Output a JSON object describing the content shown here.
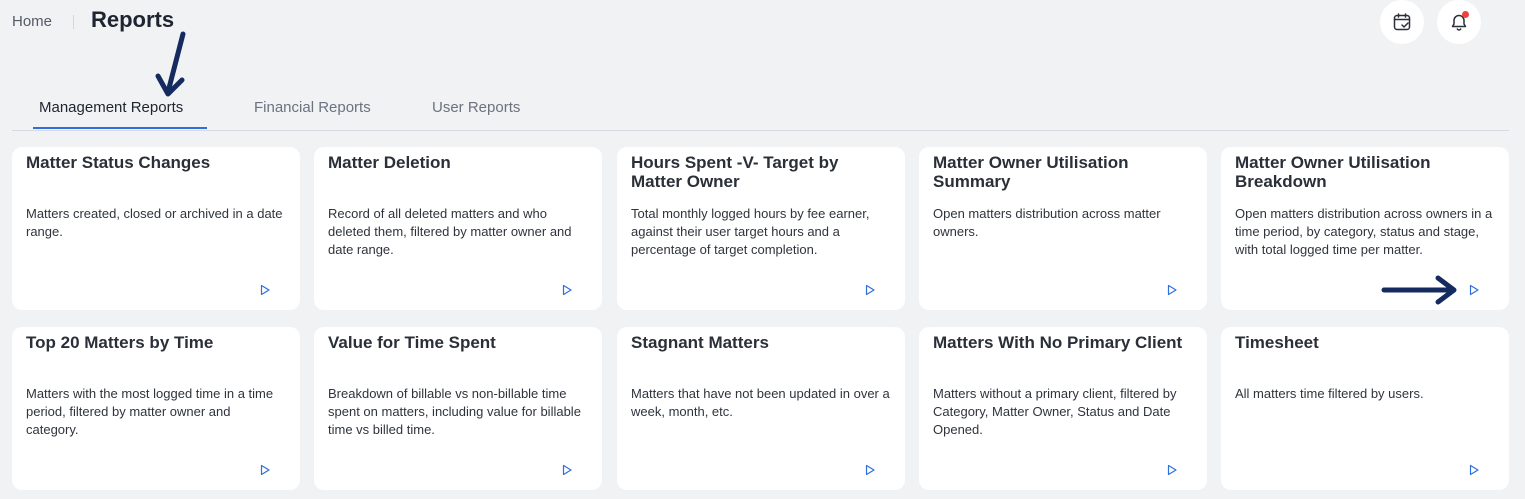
{
  "header": {
    "breadcrumb_home": "Home",
    "title": "Reports",
    "calendar_icon": "calendar-check-icon",
    "bell_icon": "bell-icon",
    "notification_dot_color": "#f0413a"
  },
  "tabs": [
    {
      "label": "Management Reports",
      "active": true
    },
    {
      "label": "Financial Reports",
      "active": false
    },
    {
      "label": "User Reports",
      "active": false
    }
  ],
  "accent_color": "#2f6fdc",
  "cards": [
    {
      "title": "Matter Status Changes",
      "description": "Matters created, closed or archived in a date range."
    },
    {
      "title": "Matter Deletion",
      "description": "Record of all deleted matters and who deleted them, filtered by matter owner and date range."
    },
    {
      "title": "Hours Spent -V- Target by Matter Owner",
      "description": "Total monthly logged hours by fee earner, against their user target hours and a percentage of target completion."
    },
    {
      "title": "Matter Owner Utilisation Summary",
      "description": "Open matters distribution across matter owners."
    },
    {
      "title": "Matter Owner Utilisation Breakdown",
      "description": "Open matters distribution across owners in a time period, by category, status and stage, with total logged time per matter."
    },
    {
      "title": "Top 20 Matters by Time",
      "description": "Matters with the most logged time in a time period, filtered by matter owner and category."
    },
    {
      "title": "Value for Time Spent",
      "description": "Breakdown of billable vs non-billable time spent on matters, including value for billable time vs billed time."
    },
    {
      "title": "Stagnant Matters",
      "description": "Matters that have not been updated in over a week, month, etc."
    },
    {
      "title": "Matters With No Primary Client",
      "description": "Matters without a primary client, filtered by Category, Matter Owner, Status and Date Opened."
    },
    {
      "title": "Timesheet",
      "description": "All matters time filtered by users."
    }
  ],
  "card_action_icon": "play-icon"
}
